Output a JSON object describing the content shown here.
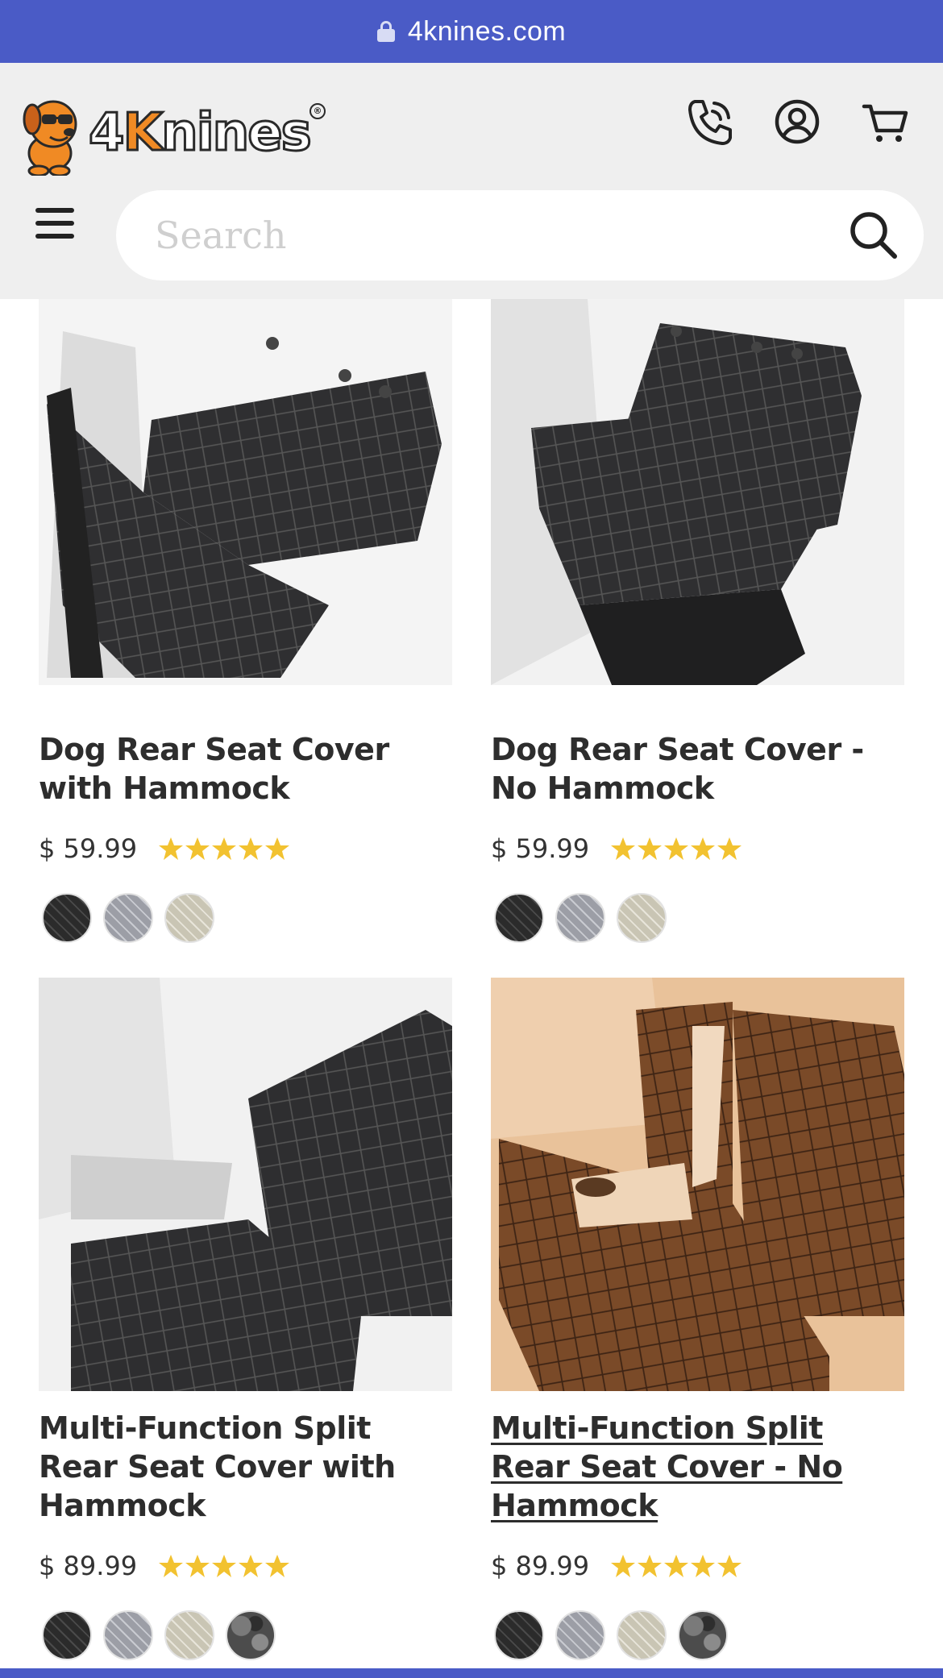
{
  "browser": {
    "url": "4knines.com"
  },
  "header": {
    "logo_text_prefix": "4",
    "logo_text_k": "K",
    "logo_text_rest": "nines",
    "logo_reg": "®",
    "icons": [
      "phone-icon",
      "account-icon",
      "cart-icon"
    ]
  },
  "search": {
    "placeholder": "Search"
  },
  "colors": {
    "brand_blue": "#4a5bc6",
    "header_bg": "#efefef",
    "star": "#f2c230",
    "logo_orange": "#f08a24"
  },
  "products": [
    {
      "title": "Dog Rear Seat Cover with Hammock",
      "price": "$ 59.99",
      "rating": 5,
      "swatches": [
        "black",
        "grey",
        "tan"
      ]
    },
    {
      "title": "Dog Rear Seat Cover - No Hammock",
      "price": "$ 59.99",
      "rating": 5,
      "swatches": [
        "black",
        "grey",
        "tan"
      ]
    },
    {
      "title": "Multi-Function Split Rear Seat Cover with Hammock",
      "price": "$ 89.99",
      "rating": 5,
      "swatches": [
        "black",
        "grey",
        "tan",
        "camo"
      ]
    },
    {
      "title": "Multi-Function Split Rear Seat Cover - No Hammock",
      "price": "$ 89.99",
      "rating": 5,
      "swatches": [
        "black",
        "grey",
        "tan",
        "camo"
      ]
    }
  ]
}
